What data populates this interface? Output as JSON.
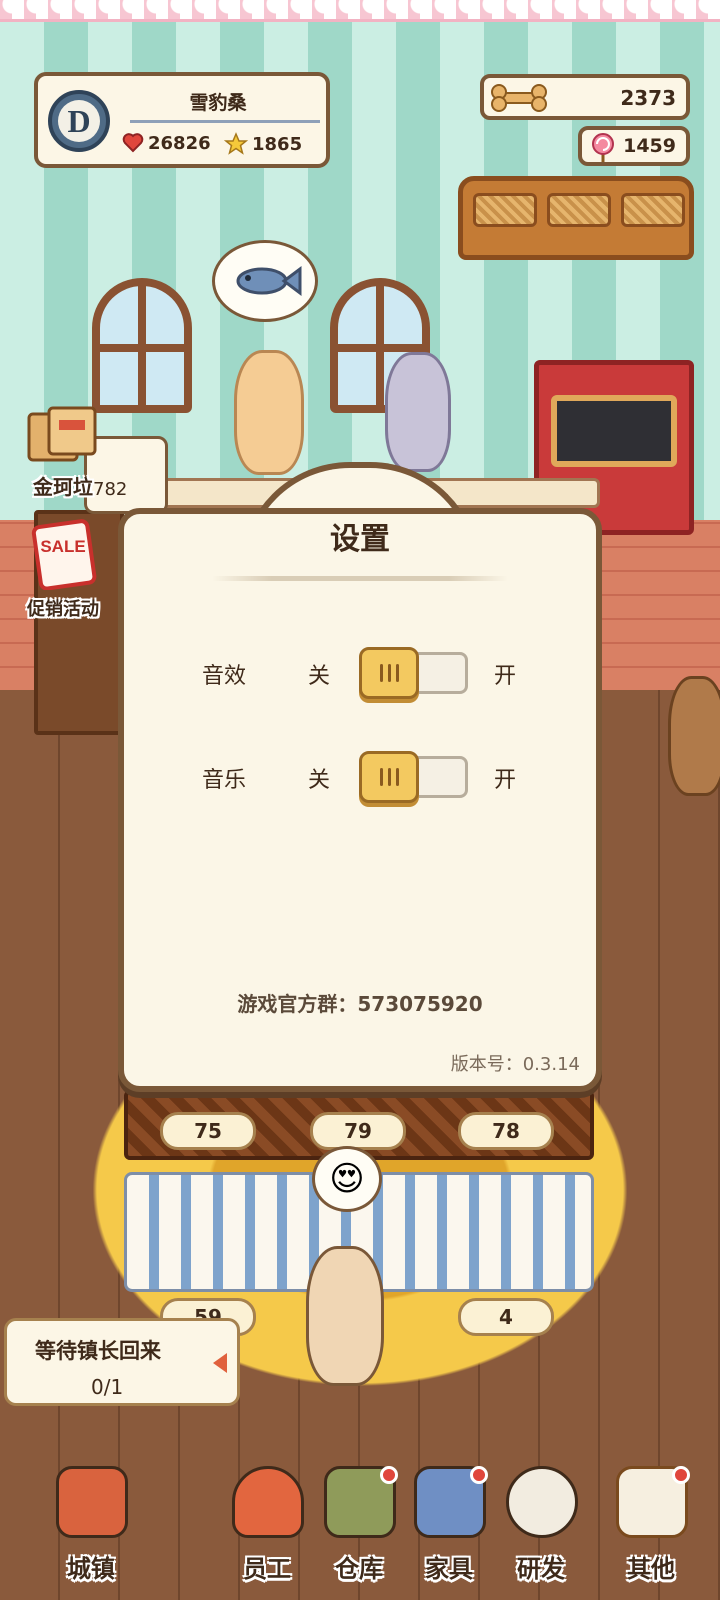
{
  "player": {
    "rank": "D",
    "name": "雪豹桑",
    "hearts": "26826",
    "stars": "1865"
  },
  "currencies": {
    "bones": "2373",
    "lollipops": "1459"
  },
  "side_buttons": {
    "shop_label": "金珂垃",
    "shop_count": "782",
    "sale_badge": "SALE",
    "promo_label": "促销活动"
  },
  "settings": {
    "title": "设置",
    "rows": [
      {
        "name": "音效",
        "off_label": "关",
        "on_label": "开",
        "state": "off"
      },
      {
        "name": "音乐",
        "off_label": "关",
        "on_label": "开",
        "state": "off"
      }
    ],
    "group_line": "游戏官方群：573075920",
    "version": "版本号：0.3.14"
  },
  "display_case": {
    "top_counts": [
      "75",
      "79",
      "78"
    ],
    "bottom_counts": [
      "59",
      "4"
    ],
    "reaction_emoji": "😍"
  },
  "quest": {
    "title": "等待镇长回来",
    "progress": "0/1"
  },
  "nav": [
    {
      "label": "城镇",
      "icon": "town-icon",
      "dot": false
    },
    {
      "label": "员工",
      "icon": "staff-icon",
      "dot": false
    },
    {
      "label": "仓库",
      "icon": "warehouse-icon",
      "dot": true
    },
    {
      "label": "家具",
      "icon": "furniture-icon",
      "dot": true
    },
    {
      "label": "研发",
      "icon": "research-icon",
      "dot": false
    },
    {
      "label": "其他",
      "icon": "other-icon",
      "dot": true
    }
  ],
  "colors": {
    "panel_bg": "#fbf6e7",
    "panel_border": "#7a5838",
    "toggle_knob": "#f3c960",
    "notification_dot": "#e0463c"
  }
}
